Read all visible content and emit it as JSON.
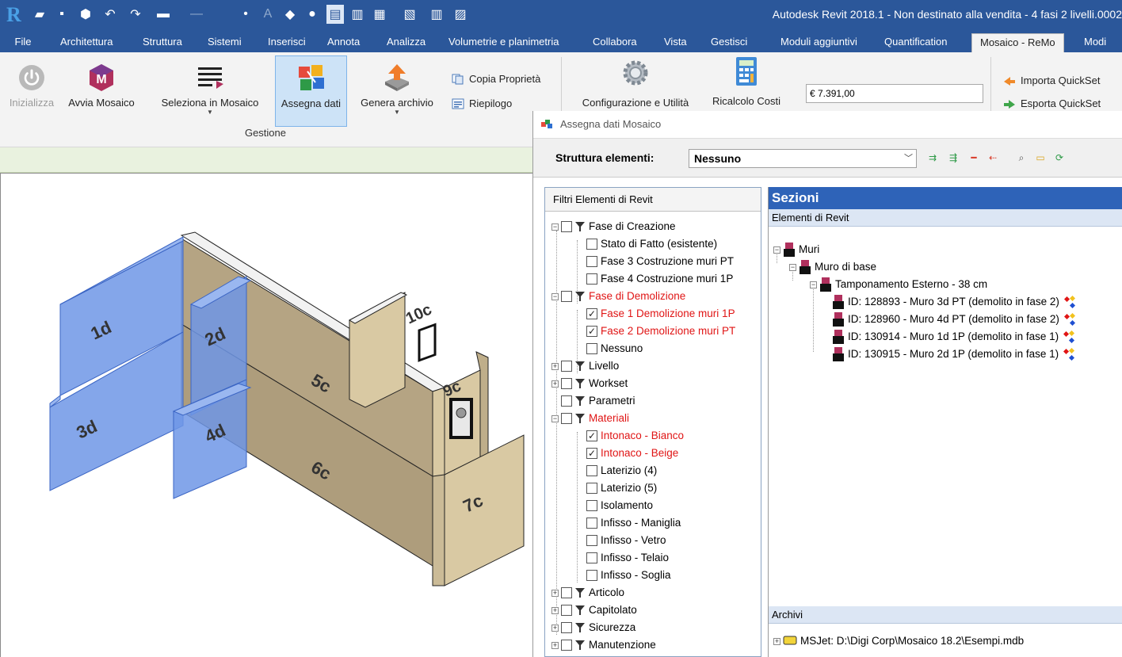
{
  "titlebar": {
    "app_logo": "R",
    "title": "Autodesk Revit 2018.1 - Non destinato alla vendita -   4 fasi 2 livelli.0002"
  },
  "tabs": [
    {
      "label": "File"
    },
    {
      "label": "Architettura"
    },
    {
      "label": "Struttura"
    },
    {
      "label": "Sistemi"
    },
    {
      "label": "Inserisci"
    },
    {
      "label": "Annota"
    },
    {
      "label": "Analizza"
    },
    {
      "label": "Volumetrie e planimetria"
    },
    {
      "label": "Collabora"
    },
    {
      "label": "Vista"
    },
    {
      "label": "Gestisci"
    },
    {
      "label": "Moduli aggiuntivi"
    },
    {
      "label": "Quantification"
    },
    {
      "label": "Mosaico - ReMo"
    },
    {
      "label": "Modi"
    }
  ],
  "ribbon": {
    "inizializza": "Inizializza",
    "avvia_mosaico": "Avvia Mosaico",
    "avvia_logo": "M",
    "seleziona": "Seleziona in Mosaico",
    "assegna": "Assegna dati",
    "genera": "Genera archivio",
    "copia_proprieta": "Copia Proprietà",
    "riepilogo": "Riepilogo",
    "configurazione": "Configurazione e Utilità",
    "ricalcolo": "Ricalcolo Costi",
    "cost_value": "€ 7.391,00",
    "importa": "Importa QuickSet",
    "esporta": "Esporta QuickSet",
    "panel_label": "Gestione"
  },
  "viewport": {
    "labels": [
      "1d",
      "2d",
      "3d",
      "4d",
      "5c",
      "6c",
      "7c",
      "9c",
      "10c"
    ]
  },
  "dialog": {
    "title": "Assegna dati Mosaico",
    "struttura_label": "Struttura elementi:",
    "struttura_value": "Nessuno",
    "filters_title": "Filtri Elementi di Revit",
    "filters": [
      {
        "label": "Fase di Creazione",
        "checked": false,
        "red": false
      },
      {
        "label": "Stato di Fatto (esistente)",
        "checked": false,
        "red": false
      },
      {
        "label": "Fase 3 Costruzione muri PT",
        "checked": false,
        "red": false
      },
      {
        "label": "Fase 4 Costruzione muri 1P",
        "checked": false,
        "red": false
      },
      {
        "label": "Fase di Demolizione",
        "checked": false,
        "red": true
      },
      {
        "label": "Fase 1 Demolizione muri 1P",
        "checked": true,
        "red": true
      },
      {
        "label": "Fase 2 Demolizione muri PT",
        "checked": true,
        "red": true
      },
      {
        "label": "Nessuno",
        "checked": false,
        "red": false
      },
      {
        "label": "Livello",
        "checked": false,
        "red": false
      },
      {
        "label": "Workset",
        "checked": false,
        "red": false
      },
      {
        "label": "Parametri",
        "checked": false,
        "red": false
      },
      {
        "label": "Materiali",
        "checked": false,
        "red": true
      },
      {
        "label": "Intonaco - Bianco",
        "checked": true,
        "red": true
      },
      {
        "label": "Intonaco - Beige",
        "checked": true,
        "red": true
      },
      {
        "label": "Laterizio (4)",
        "checked": false,
        "red": false
      },
      {
        "label": "Laterizio (5)",
        "checked": false,
        "red": false
      },
      {
        "label": "Isolamento",
        "checked": false,
        "red": false
      },
      {
        "label": "Infisso - Maniglia",
        "checked": false,
        "red": false
      },
      {
        "label": "Infisso - Vetro",
        "checked": false,
        "red": false
      },
      {
        "label": "Infisso - Telaio",
        "checked": false,
        "red": false
      },
      {
        "label": "Infisso - Soglia",
        "checked": false,
        "red": false
      },
      {
        "label": "Articolo",
        "checked": false,
        "red": false
      },
      {
        "label": "Capitolato",
        "checked": false,
        "red": false
      },
      {
        "label": "Sicurezza",
        "checked": false,
        "red": false
      },
      {
        "label": "Manutenzione",
        "checked": false,
        "red": false
      }
    ],
    "sezioni_title": "Sezioni",
    "elementi_title": "Elementi di Revit",
    "tree": [
      {
        "label": "Muri",
        "badge": "c"
      },
      {
        "label": "Muro di base",
        "badge": "FM"
      },
      {
        "label": "Tamponamento Esterno - 38 cm",
        "badge": "T"
      },
      {
        "label": "ID: 128893 - Muro 3d PT (demolito in fase 2)",
        "badge": "E"
      },
      {
        "label": "ID: 128960 - Muro 4d PT (demolito in fase 2)",
        "badge": "E"
      },
      {
        "label": "ID: 130914 - Muro 1d 1P (demolito in fase 1)",
        "badge": "E"
      },
      {
        "label": "ID: 130915 - Muro 2d 1P (demolito in fase 1)",
        "badge": "E"
      }
    ],
    "archivi_title": "Archivi",
    "archivio": "MSJet: D:\\Digi Corp\\Mosaico 18.2\\Esempi.mdb"
  },
  "colors": {
    "title_blue": "#2b579a",
    "section_blue": "#2e63b8",
    "red_text": "#e01515",
    "selection_blue": "#5f8ee3",
    "wall_beige": "#d9c9a3"
  }
}
